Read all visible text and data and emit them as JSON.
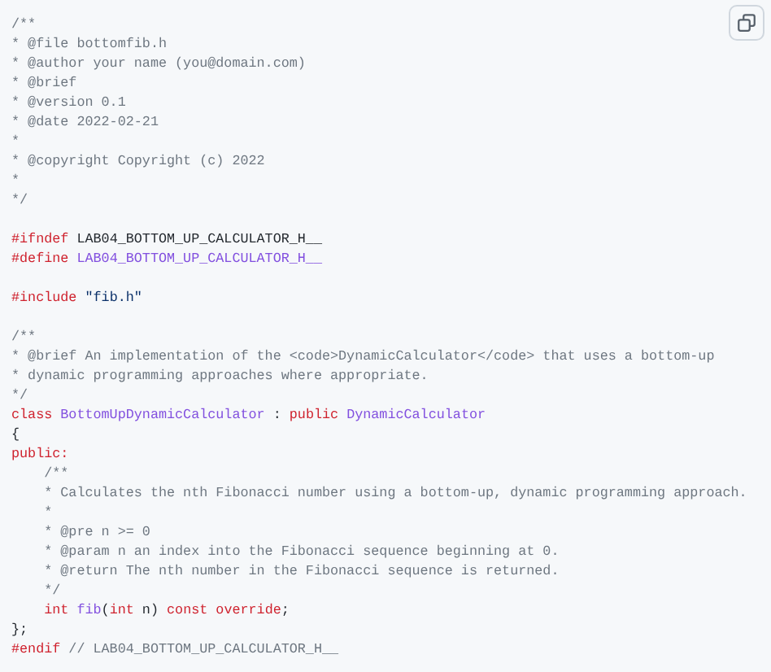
{
  "code_block": {
    "blocks": [
      {
        "lines": [
          {
            "tokens": [
              {
                "text": "/**",
                "kind": "comment"
              }
            ]
          },
          {
            "tokens": [
              {
                "text": "* @file bottomfib.h",
                "kind": "comment"
              }
            ]
          },
          {
            "tokens": [
              {
                "text": "* @author your name (you@domain.com)",
                "kind": "comment"
              }
            ]
          },
          {
            "tokens": [
              {
                "text": "* @brief",
                "kind": "comment"
              }
            ]
          },
          {
            "tokens": [
              {
                "text": "* @version 0.1",
                "kind": "comment"
              }
            ]
          },
          {
            "tokens": [
              {
                "text": "* @date 2022-02-21",
                "kind": "comment"
              }
            ]
          },
          {
            "tokens": [
              {
                "text": "*",
                "kind": "comment"
              }
            ]
          },
          {
            "tokens": [
              {
                "text": "* @copyright Copyright (c) 2022",
                "kind": "comment"
              }
            ]
          },
          {
            "tokens": [
              {
                "text": "*",
                "kind": "comment"
              }
            ]
          },
          {
            "tokens": [
              {
                "text": "*/",
                "kind": "comment"
              }
            ]
          }
        ]
      },
      {
        "lines": [
          {
            "tokens": [
              {
                "text": "#ifndef",
                "kind": "keyword"
              },
              {
                "text": " LAB04_BOTTOM_UP_CALCULATOR_H__",
                "kind": "plain"
              }
            ]
          },
          {
            "tokens": [
              {
                "text": "#define",
                "kind": "keyword"
              },
              {
                "text": " LAB04_BOTTOM_UP_CALCULATOR_H__",
                "kind": "entity"
              }
            ]
          }
        ]
      },
      {
        "lines": [
          {
            "tokens": [
              {
                "text": "#include",
                "kind": "keyword"
              },
              {
                "text": " \"fib.h\"",
                "kind": "string"
              }
            ]
          }
        ]
      },
      {
        "lines": [
          {
            "tokens": [
              {
                "text": "/**",
                "kind": "comment"
              }
            ]
          },
          {
            "tokens": [
              {
                "text": "* @brief An implementation of the <code>DynamicCalculator</code> that uses a bottom-up",
                "kind": "comment"
              }
            ]
          },
          {
            "tokens": [
              {
                "text": "* dynamic programming approaches where appropriate.",
                "kind": "comment"
              }
            ]
          },
          {
            "tokens": [
              {
                "text": "*/",
                "kind": "comment"
              }
            ]
          },
          {
            "tokens": [
              {
                "text": "class ",
                "kind": "keyword"
              },
              {
                "text": "BottomUpDynamicCalculator",
                "kind": "entity"
              },
              {
                "text": " : ",
                "kind": "plain"
              },
              {
                "text": "public ",
                "kind": "keyword"
              },
              {
                "text": "DynamicCalculator",
                "kind": "entity"
              }
            ]
          },
          {
            "tokens": [
              {
                "text": "{",
                "kind": "plain"
              }
            ]
          },
          {
            "tokens": [
              {
                "text": "public:",
                "kind": "keyword"
              }
            ]
          },
          {
            "tokens": [
              {
                "text": "    /**",
                "kind": "comment"
              }
            ]
          },
          {
            "tokens": [
              {
                "text": "    * Calculates the nth Fibonacci number using a bottom-up, dynamic programming approach.",
                "kind": "comment"
              }
            ]
          },
          {
            "tokens": [
              {
                "text": "    *",
                "kind": "comment"
              }
            ]
          },
          {
            "tokens": [
              {
                "text": "    * @pre n >= 0",
                "kind": "comment"
              }
            ]
          },
          {
            "tokens": [
              {
                "text": "    * @param n an index into the Fibonacci sequence beginning at 0.",
                "kind": "comment"
              }
            ]
          },
          {
            "tokens": [
              {
                "text": "    * @return The nth number in the Fibonacci sequence is returned.",
                "kind": "comment"
              }
            ]
          },
          {
            "tokens": [
              {
                "text": "    */",
                "kind": "comment"
              }
            ]
          },
          {
            "tokens": [
              {
                "text": "    int ",
                "kind": "keyword"
              },
              {
                "text": "fib",
                "kind": "entity"
              },
              {
                "text": "(",
                "kind": "plain"
              },
              {
                "text": "int",
                "kind": "keyword"
              },
              {
                "text": " n) ",
                "kind": "plain"
              },
              {
                "text": "const override",
                "kind": "keyword"
              },
              {
                "text": ";",
                "kind": "plain"
              }
            ]
          },
          {
            "tokens": [
              {
                "text": "};",
                "kind": "plain"
              }
            ]
          },
          {
            "tokens": [
              {
                "text": "#endif",
                "kind": "keyword"
              },
              {
                "text": " // LAB04_BOTTOM_UP_CALCULATOR_H__",
                "kind": "comment"
              }
            ]
          }
        ]
      }
    ]
  }
}
